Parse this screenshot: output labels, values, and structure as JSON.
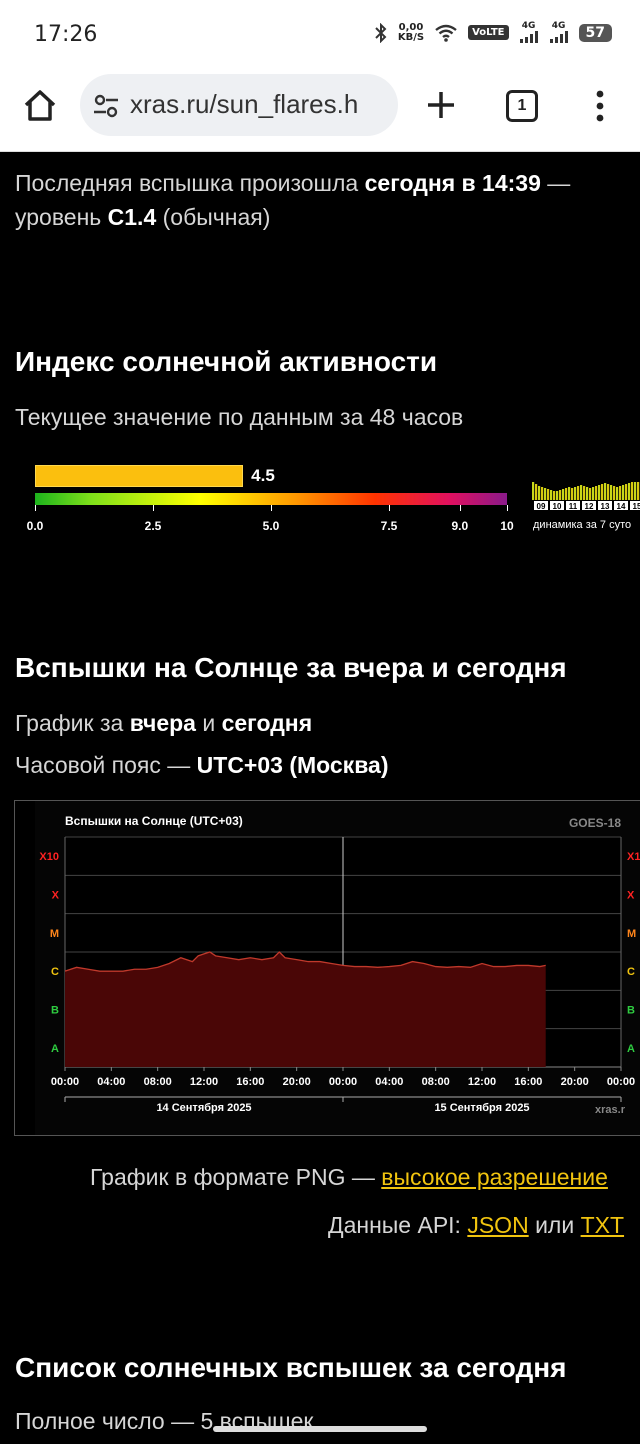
{
  "status_bar": {
    "time": "17:26",
    "net_speed_value": "0,00",
    "net_speed_unit": "KB/S",
    "volte": "VoLTE",
    "sim1": "4G",
    "sim2": "4G",
    "battery": "57"
  },
  "browser": {
    "url": "xras.ru/sun_flares.h",
    "tab_count": "1"
  },
  "last_flare": {
    "prefix": "Последняя вспышка произошла ",
    "when": "сегодня в 14:39",
    "dash": " —",
    "level_prefix": "уровень ",
    "level": "C1.4",
    "level_suffix": " (обычная)"
  },
  "activity_index": {
    "heading": "Индекс солнечной активности",
    "subtitle": "Текущее значение по данным за 48 часов",
    "value": 4.5,
    "value_label": "4.5",
    "scale_max": 10,
    "ticks": [
      "0.0",
      "2.5",
      "5.0",
      "7.5",
      "9.0",
      "10"
    ],
    "tick_values": [
      0,
      2.5,
      5.0,
      7.5,
      9.0,
      10
    ],
    "mini_days": [
      "09",
      "10",
      "11",
      "12",
      "13",
      "14",
      "15"
    ],
    "mini_label": "динамика за 7 суто"
  },
  "flares_section": {
    "heading": "Вспышки на Солнце за вчера и сегодня",
    "graph_prefix": "График за ",
    "graph_yesterday": "вчера",
    "graph_and": " и ",
    "graph_today": "сегодня",
    "tz_prefix": "Часовой пояс — ",
    "tz_value": "UTC+03 (Москва)"
  },
  "chart_data": {
    "type": "area",
    "title": "Вспышки на Солнце (UTC+03)",
    "source": "GOES-18",
    "watermark": "xras.r",
    "y_classes": [
      "A",
      "B",
      "C",
      "M",
      "X",
      "X10"
    ],
    "y_class_colors": [
      "#2ecc40",
      "#2ecc40",
      "#f1c40f",
      "#ff851b",
      "#ff2222",
      "#ff2222"
    ],
    "x_ticks": [
      "00:00",
      "04:00",
      "08:00",
      "12:00",
      "16:00",
      "20:00",
      "00:00",
      "04:00",
      "08:00",
      "12:00",
      "16:00",
      "20:00",
      "00:00"
    ],
    "day_labels": [
      "14 Сентября 2025",
      "15 Сентября 2025"
    ],
    "series": [
      {
        "hours": [
          0,
          1,
          2,
          3,
          4,
          5,
          6,
          7,
          8,
          9,
          10,
          11,
          11.5,
          12,
          12.5,
          13,
          14,
          15,
          16,
          17,
          18,
          18.5,
          19,
          20,
          21,
          22,
          23,
          24,
          25,
          26,
          27,
          28,
          29,
          30,
          31,
          32,
          33,
          34,
          35,
          36,
          37,
          38,
          39,
          40,
          41,
          41.5
        ],
        "levels": [
          2.5,
          2.6,
          2.55,
          2.5,
          2.5,
          2.5,
          2.55,
          2.55,
          2.6,
          2.7,
          2.85,
          2.75,
          2.9,
          2.95,
          3.0,
          2.9,
          2.85,
          2.8,
          2.85,
          2.8,
          2.85,
          3.0,
          2.85,
          2.8,
          2.75,
          2.75,
          2.7,
          2.65,
          2.62,
          2.62,
          2.6,
          2.62,
          2.65,
          2.75,
          2.7,
          2.62,
          2.6,
          2.62,
          2.6,
          2.7,
          2.62,
          2.62,
          2.65,
          2.65,
          2.62,
          2.65
        ]
      }
    ]
  },
  "png_line": {
    "prefix": "График в формате PNG — ",
    "link": "высокое разрешение"
  },
  "api_line": {
    "prefix": "Данные API: ",
    "json": "JSON",
    "or": " или ",
    "txt": "TXT"
  },
  "list_section": {
    "heading": "Список солнечных вспышек за сегодня",
    "partial_text": "Полное число — 5 вспышек"
  }
}
